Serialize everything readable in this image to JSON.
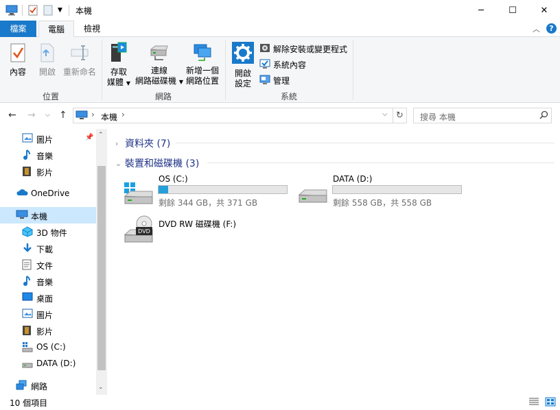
{
  "window": {
    "title": "本機"
  },
  "ribbon_tabs": {
    "file": "檔案",
    "computer": "電腦",
    "view": "檢視"
  },
  "ribbon": {
    "location_group": {
      "label": "位置",
      "properties": "內容",
      "open": "開啟",
      "rename": "重新命名"
    },
    "network_group": {
      "label": "網路",
      "access_media_l1": "存取",
      "access_media_l2": "媒體",
      "map_drive_l1": "連線",
      "map_drive_l2": "網路磁碟機",
      "add_location_l1": "新增一個",
      "add_location_l2": "網路位置"
    },
    "system_group": {
      "label": "系統",
      "open_settings_l1": "開啟",
      "open_settings_l2": "設定",
      "uninstall": "解除安裝或變更程式",
      "system_properties": "系統內容",
      "manage": "管理"
    }
  },
  "address": {
    "location": "本機"
  },
  "search": {
    "placeholder": "搜尋 本機"
  },
  "nav_pane": {
    "quick_items": [
      {
        "label": "圖片",
        "icon": "pictures-icon"
      },
      {
        "label": "音樂",
        "icon": "music-icon"
      },
      {
        "label": "影片",
        "icon": "videos-icon"
      }
    ],
    "onedrive": "OneDrive",
    "this_pc": "本機",
    "pc_items": [
      {
        "label": "3D 物件",
        "icon": "3d-objects-icon"
      },
      {
        "label": "下載",
        "icon": "downloads-icon"
      },
      {
        "label": "文件",
        "icon": "documents-icon"
      },
      {
        "label": "音樂",
        "icon": "music-icon"
      },
      {
        "label": "桌面",
        "icon": "desktop-icon"
      },
      {
        "label": "圖片",
        "icon": "pictures-icon"
      },
      {
        "label": "影片",
        "icon": "videos-icon"
      },
      {
        "label": "OS (C:)",
        "icon": "drive-c-icon"
      },
      {
        "label": "DATA (D:)",
        "icon": "drive-d-icon"
      }
    ],
    "network": "網路"
  },
  "content": {
    "folders_header": "資料夾 (7)",
    "devices_header": "裝置和磁碟機 (3)",
    "drives": [
      {
        "name": "OS (C:)",
        "info": "剩餘 344 GB，共 371 GB",
        "used_fraction": 0.073
      },
      {
        "name": "DATA (D:)",
        "info": "剩餘 558 GB，共 558 GB",
        "used_fraction": 0.0
      },
      {
        "name": "DVD RW 磁碟機 (F:)",
        "dvd_label": "DVD"
      }
    ]
  },
  "status": {
    "item_count": "10 個項目"
  },
  "colors": {
    "accent": "#1979ca",
    "selected": "#cce8ff",
    "bar_fill": "#26a0da",
    "header_text": "#1e3287"
  }
}
